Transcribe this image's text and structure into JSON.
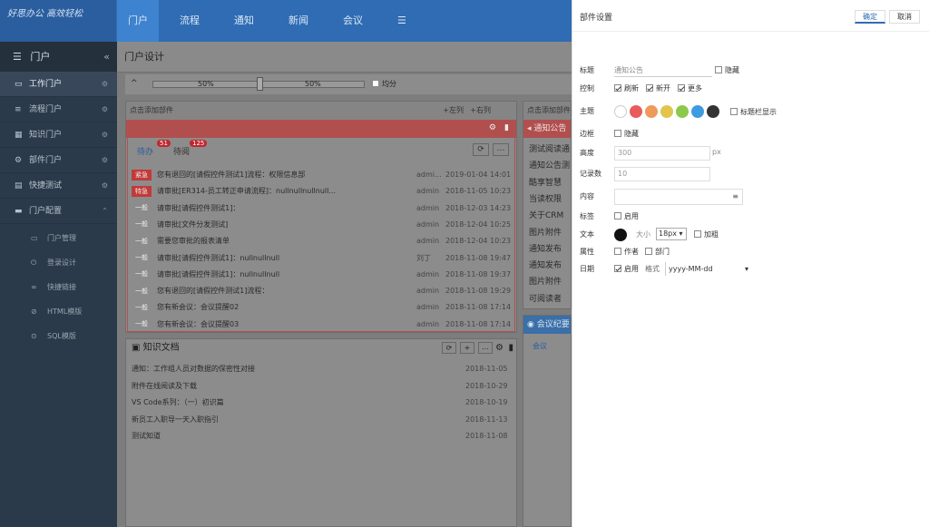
{
  "app": {
    "logo_text": "好思办公 高效轻松",
    "nav": [
      "门户",
      "流程",
      "通知",
      "新闻",
      "会议"
    ],
    "menu_icon": "hamburger-icon"
  },
  "sidebar": {
    "header": "门户",
    "collapse_icon": "«",
    "items": [
      {
        "label": "工作门户",
        "icon": "monitor-icon"
      },
      {
        "label": "流程门户",
        "icon": "list-icon"
      },
      {
        "label": "知识门户",
        "icon": "grid-icon"
      },
      {
        "label": "部件门户",
        "icon": "gear-icon"
      },
      {
        "label": "快捷测试",
        "icon": "doc-icon"
      },
      {
        "label": "门户配置",
        "icon": "folder-icon"
      }
    ],
    "subitems": [
      {
        "label": "门户管理",
        "icon": "window-icon"
      },
      {
        "label": "登录设计",
        "icon": "power-icon"
      },
      {
        "label": "快捷链接",
        "icon": "link-icon"
      },
      {
        "label": "HTML模版",
        "icon": "code-icon"
      },
      {
        "label": "SQL模版",
        "icon": "db-icon"
      }
    ]
  },
  "main": {
    "page_title": "门户设计",
    "slider": {
      "left": "50%",
      "right": "50%",
      "split_label": "均分",
      "collapse": "^"
    },
    "todo_panel": {
      "hint": "点击添加部件",
      "add_left": "+左列",
      "add_right": "+右列",
      "tabs": [
        {
          "label": "待办",
          "badge": "51"
        },
        {
          "label": "待阅",
          "badge": "125"
        }
      ],
      "rows": [
        {
          "tag": "紧急",
          "tag_color": "#c23a3a",
          "title": "您有退回的[请假控件测试1]流程：权限信息部",
          "user": "admi...",
          "time": "2019-01-04 14:01"
        },
        {
          "tag": "特急",
          "tag_color": "#c23a3a",
          "title": "请审批[ER314-员工转正申请流程]：nullnullnullnull...",
          "user": "admin",
          "time": "2018-11-05 10:23"
        },
        {
          "tag": "一般",
          "tag_color": "#8c8c8c",
          "title": "请审批[请假控件测试1]：",
          "user": "admin",
          "time": "2018-12-03 14:23"
        },
        {
          "tag": "一般",
          "tag_color": "#8c8c8c",
          "title": "请审批[文件分发测试]",
          "user": "admin",
          "time": "2018-12-04 10:25"
        },
        {
          "tag": "一般",
          "tag_color": "#8c8c8c",
          "title": "需要您审批的报表清单",
          "user": "admin",
          "time": "2018-12-04 10:23"
        },
        {
          "tag": "一般",
          "tag_color": "#8c8c8c",
          "title": "请审批[请假控件测试1]：nullnullnull",
          "user": "刘丁",
          "time": "2018-11-08 19:47"
        },
        {
          "tag": "一般",
          "tag_color": "#8c8c8c",
          "title": "请审批[请假控件测试1]：nullnullnull",
          "user": "admin",
          "time": "2018-11-08 19:37"
        },
        {
          "tag": "一般",
          "tag_color": "#8c8c8c",
          "title": "您有退回的[请假控件测试1]流程：",
          "user": "admin",
          "time": "2018-11-08 19:29"
        },
        {
          "tag": "一般",
          "tag_color": "#8c8c8c",
          "title": "您有新会议：会议提醒02",
          "user": "admin",
          "time": "2018-11-08 17:14"
        },
        {
          "tag": "一般",
          "tag_color": "#8c8c8c",
          "title": "您有新会议：会议提醒03",
          "user": "admin",
          "time": "2018-11-08 17:14"
        }
      ]
    },
    "knowledge_panel": {
      "title": "知识文档",
      "rows": [
        {
          "title": "通知：工作组人员对数据的保密性对接",
          "date": "2018-11-05"
        },
        {
          "title": "附件在线阅读及下载",
          "date": "2018-10-29"
        },
        {
          "title": "VS Code系列：（一）初识篇",
          "date": "2018-10-19"
        },
        {
          "title": "新员工入职导一天入职指引",
          "date": "2018-11-13"
        },
        {
          "title": "测试知道",
          "date": "2018-11-08"
        }
      ]
    },
    "notice_panel": {
      "hint": "点击添加部件",
      "title": "通知公告",
      "rows": [
        "测试阅读通",
        "通知公告测",
        "酷享智慧",
        "当读权限",
        "关于CRM",
        "图片附件",
        "通知发布",
        "通知发布",
        "图片附件",
        "可阅读者"
      ]
    },
    "meeting_panel": {
      "title": "会议纪要",
      "tab": "会议"
    }
  },
  "settings": {
    "title": "部件设置",
    "confirm": "确定",
    "cancel": "取消",
    "labels": {
      "title": "标题",
      "features": "控制",
      "theme": "主题",
      "border": "边框",
      "height": "高度",
      "rowcount": "记录数",
      "content": "内容",
      "tag": "标签",
      "text": "文本",
      "attr": "属性",
      "date": "日期"
    },
    "title_value": "通知公告",
    "hide_label": "隐藏",
    "features": [
      "刷新",
      "新开",
      "更多"
    ],
    "colors": [
      "#ffffff",
      "#e95c5c",
      "#ef9a5a",
      "#e2c54a",
      "#8cc94a",
      "#3d9be0",
      "#333333"
    ],
    "title_bar_label": "标题栏显示",
    "border_label": "隐藏",
    "height_value": "300",
    "height_unit": "px",
    "rowcount_value": "10",
    "content_icon": "≡",
    "tag_label": "启用",
    "font_size_label": "大小",
    "font_size_value": "18px",
    "bold_label": "加粗",
    "author_label": "作者",
    "dept_label": "部门",
    "date_enable": "启用",
    "date_format_label": "格式",
    "date_format_value": "yyyy-MM-dd"
  }
}
